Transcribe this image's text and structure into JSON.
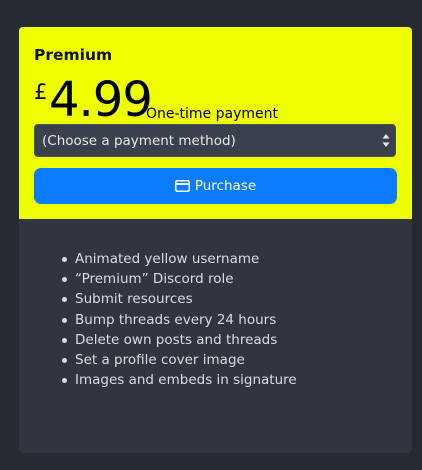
{
  "plan": {
    "title": "Premium",
    "currency_symbol": "£",
    "price": "4.99",
    "price_note": "One-time payment",
    "header_color": "#eeff00"
  },
  "payment_select": {
    "selected": "(Choose a payment method)",
    "icon": "select-arrows-icon"
  },
  "purchase_button": {
    "label": "Purchase",
    "icon": "credit-card-icon",
    "color": "#0b7cff"
  },
  "features": [
    "Animated yellow username",
    "“Premium” Discord role",
    "Submit resources",
    "Bump threads every 24 hours",
    "Delete own posts and threads",
    "Set a profile cover image",
    "Images and embeds in signature"
  ]
}
